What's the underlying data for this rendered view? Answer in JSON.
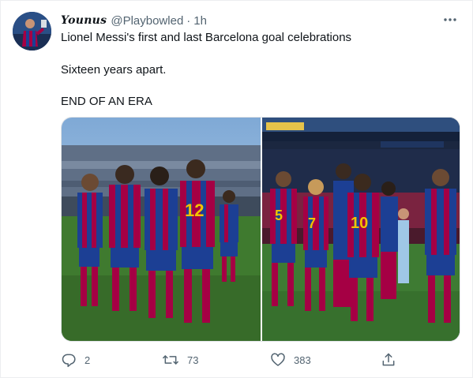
{
  "tweet": {
    "author": {
      "display_name": "Younus",
      "handle": "@Playbowled",
      "separator": "·",
      "time": "1h"
    },
    "text_lines": [
      "Lionel Messi's first and last Barcelona goal celebrations",
      "Sixteen years apart.",
      "END OF AN ERA"
    ],
    "media": [
      {
        "description_icon": "photo-first-goal-celebration"
      },
      {
        "description_icon": "photo-last-goal-celebration"
      }
    ],
    "actions": {
      "replies": "2",
      "retweets": "73",
      "likes": "383"
    },
    "icons": {
      "more": "more-horizontal-icon",
      "reply": "reply-icon",
      "retweet": "retweet-icon",
      "like": "heart-icon",
      "share": "share-icon"
    },
    "colors": {
      "text": "#0f1419",
      "secondary": "#536471",
      "barca_blue": "#1c3f94",
      "barca_red": "#a50044",
      "pitch_green": "#3f7a2f"
    }
  }
}
